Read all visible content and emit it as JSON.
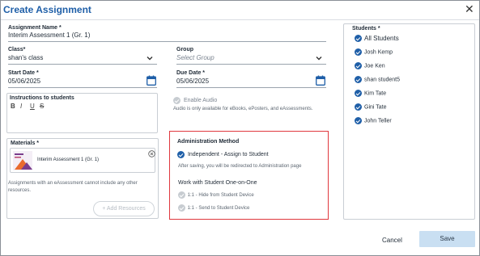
{
  "dialog": {
    "title": "Create Assignment",
    "close_icon": "close-icon"
  },
  "assignment_name": {
    "label": "Assignment Name *",
    "value": "Interim Assessment 1 (Gr. 1)"
  },
  "class": {
    "label": "Class*",
    "value": "shan's class"
  },
  "group": {
    "label": "Group",
    "placeholder": "Select Group"
  },
  "start_date": {
    "label": "Start Date *",
    "value": "05/06/2025"
  },
  "due_date": {
    "label": "Due Date *",
    "value": "05/06/2025"
  },
  "instructions": {
    "label": "Instructions to students",
    "format_bold": "B",
    "format_italic": "I",
    "format_underline": "U",
    "format_strike": "S"
  },
  "audio": {
    "label": "Enable Audio",
    "note": "Audio is only available for eBooks, ePosters, and eAssessments."
  },
  "materials": {
    "label": "Materials *",
    "item_title": "Interim Assessment 1 (Gr. 1)",
    "note": "Assignments with an eAssessment cannot include any other resources.",
    "add_button": "+ Add Resources"
  },
  "administration": {
    "title": "Administration Method",
    "independent_label": "Independent - Assign to Student",
    "independent_note": "After saving, you will be redirected to Administration page",
    "one_on_one_title": "Work with Student One-on-One",
    "option_hide": "1:1 - Hide from Student Device",
    "option_send": "1:1 - Send to Student Device",
    "highlight_color": "#e0383e"
  },
  "students": {
    "label": "Students *",
    "items": [
      "All Students",
      "Josh Kemp",
      "Joe Ken",
      "shan student5",
      "Kim Tate",
      "Gini Tate",
      "John Teller"
    ]
  },
  "footer": {
    "cancel": "Cancel",
    "save": "Save"
  },
  "colors": {
    "accent": "#1f5fa8",
    "save_bg": "#c9dff2"
  }
}
